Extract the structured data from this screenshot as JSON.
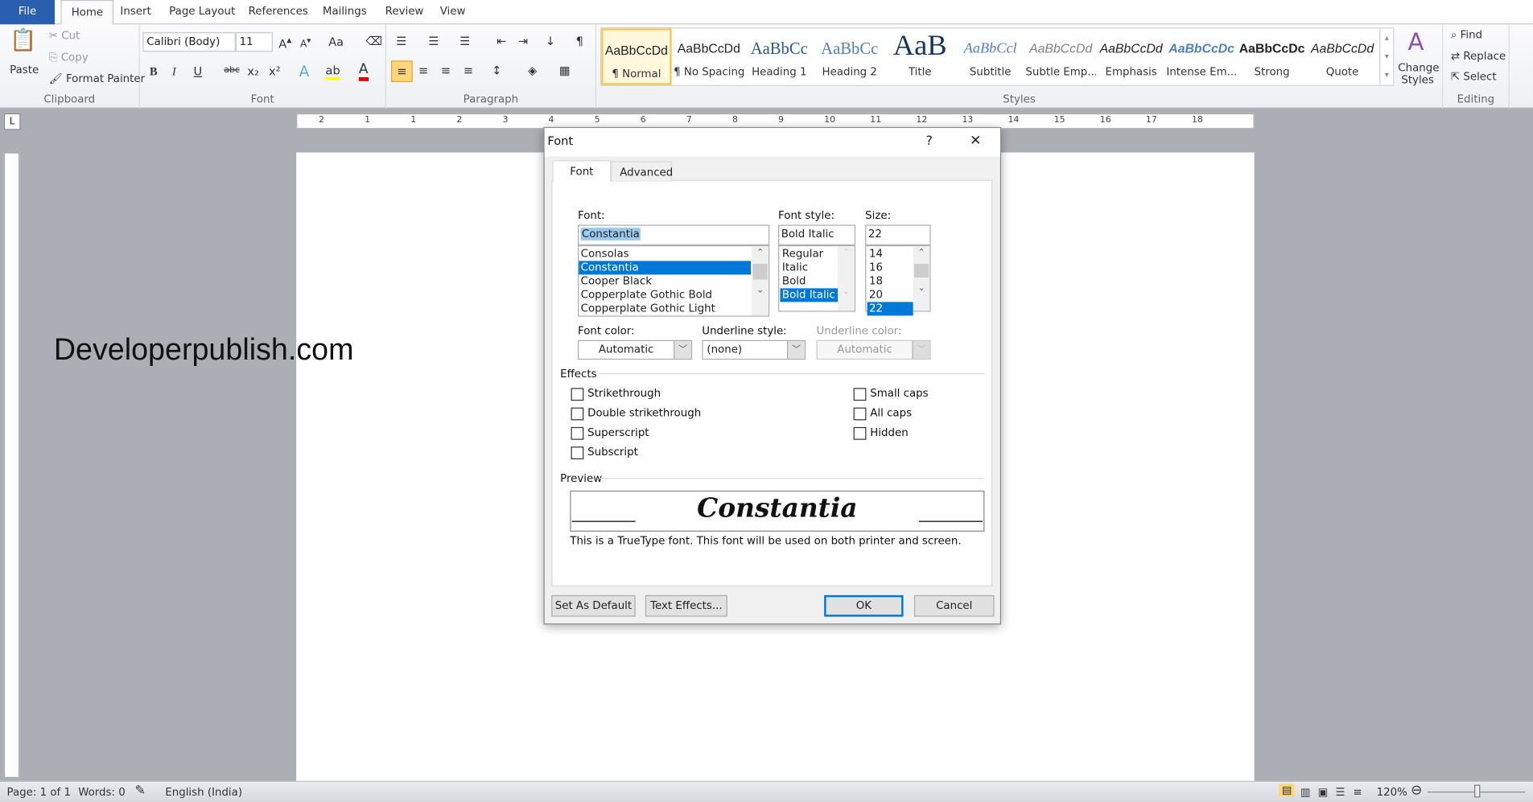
{
  "ribbon_tabs": [
    "File",
    "Home",
    "Insert",
    "Page Layout",
    "References",
    "Mailings",
    "Review",
    "View"
  ],
  "clipboard": {
    "paste": "Paste",
    "cut": "Cut",
    "copy": "Copy",
    "format_painter": "Format Painter",
    "label": "Clipboard"
  },
  "font_group": {
    "font_name": "Calibri (Body)",
    "font_size": "11",
    "label": "Font",
    "bold": "B",
    "italic": "I",
    "underline": "U",
    "strike": "abc",
    "change_case": "Aa",
    "font_color": "#e00000"
  },
  "paragraph_group": {
    "label": "Paragraph"
  },
  "styles": {
    "label": "Styles",
    "items": [
      {
        "preview": "AaBbCcDd",
        "name": "¶ Normal"
      },
      {
        "preview": "AaBbCcDd",
        "name": "¶ No Spacing"
      },
      {
        "preview": "AaBbCc",
        "name": "Heading 1"
      },
      {
        "preview": "AaBbCc",
        "name": "Heading 2"
      },
      {
        "preview": "AaB",
        "name": "Title"
      },
      {
        "preview": "AaBbCcl",
        "name": "Subtitle"
      },
      {
        "preview": "AaBbCcDd",
        "name": "Subtle Emp..."
      },
      {
        "preview": "AaBbCcDd",
        "name": "Emphasis"
      },
      {
        "preview": "AaBbCcDc",
        "name": "Intense Em..."
      },
      {
        "preview": "AaBbCcDc",
        "name": "Strong"
      },
      {
        "preview": "AaBbCcDd",
        "name": "Quote"
      }
    ],
    "change_styles": "Change Styles"
  },
  "editing": {
    "label": "Editing",
    "find": "Find",
    "replace": "Replace",
    "select": "Select"
  },
  "ruler_numbers": [
    "2",
    "1",
    "1",
    "2",
    "3",
    "4",
    "5",
    "6",
    "7",
    "8",
    "9",
    "10",
    "11",
    "12",
    "13",
    "14",
    "15",
    "16",
    "17",
    "18"
  ],
  "document": {
    "text": "Developerpublish.com"
  },
  "dialog": {
    "title": "Font",
    "help": "?",
    "close": "✕",
    "tabs": [
      "Font",
      "Advanced"
    ],
    "font_label": "Font:",
    "font_value": "Constantia",
    "font_list": [
      "Consolas",
      "Constantia",
      "Cooper Black",
      "Copperplate Gothic Bold",
      "Copperplate Gothic Light"
    ],
    "font_selected": "Constantia",
    "style_label": "Font style:",
    "style_value": "Bold Italic",
    "style_list": [
      "Regular",
      "Italic",
      "Bold",
      "Bold Italic"
    ],
    "size_label": "Size:",
    "size_value": "22",
    "size_list": [
      "14",
      "16",
      "18",
      "20",
      "22"
    ],
    "font_color_label": "Font color:",
    "font_color_value": "Automatic",
    "underline_style_label": "Underline style:",
    "underline_style_value": "(none)",
    "underline_color_label": "Underline color:",
    "underline_color_value": "Automatic",
    "effects_label": "Effects",
    "effects_left": [
      "Strikethrough",
      "Double strikethrough",
      "Superscript",
      "Subscript"
    ],
    "effects_right": [
      "Small caps",
      "All caps",
      "Hidden"
    ],
    "preview_label": "Preview",
    "preview_text": "Constantia",
    "preview_note": "This is a TrueType font. This font will be used on both printer and screen.",
    "buttons": {
      "default": "Set As Default",
      "effects": "Text Effects...",
      "ok": "OK",
      "cancel": "Cancel"
    }
  },
  "status": {
    "page": "Page: 1 of 1",
    "words": "Words: 0",
    "language": "English (India)",
    "zoom": "120%"
  }
}
